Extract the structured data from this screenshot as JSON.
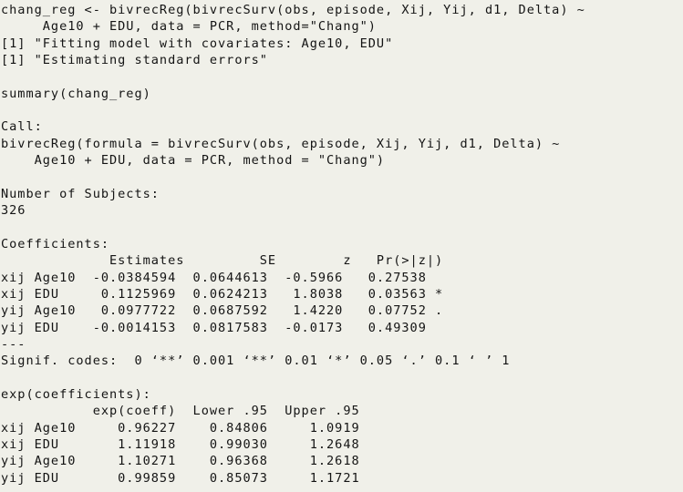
{
  "console": {
    "app": "R Console",
    "background_color": "#f0f0e9",
    "text_color": "#141414",
    "font_size_px": 13.6,
    "line_height_px": 18.35,
    "lines": [
      "chang_reg <- bivrecReg(bivrecSurv(obs, episode, Xij, Yij, d1, Delta) ~",
      "     Age10 + EDU, data = PCR, method=\"Chang\")",
      "[1] \"Fitting model with covariates: Age10, EDU\"",
      "[1] \"Estimating standard errors\"",
      "",
      "summary(chang_reg)",
      "",
      "Call:",
      "bivrecReg(formula = bivrecSurv(obs, episode, Xij, Yij, d1, Delta) ~",
      "    Age10 + EDU, data = PCR, method = \"Chang\")",
      "",
      "Number of Subjects:",
      "326",
      "",
      "Coefficients:",
      "             Estimates         SE        z   Pr(>|z|)",
      "xij Age10  -0.0384594  0.0644613  -0.5966   0.27538",
      "xij EDU     0.1125969  0.0624213   1.8038   0.03563 *",
      "yij Age10   0.0977722  0.0687592   1.4220   0.07752 .",
      "yij EDU    -0.0014153  0.0817583  -0.0173   0.49309",
      "---",
      "Signif. codes:  0 ‘**’ 0.001 ‘**’ 0.01 ‘*’ 0.05 ‘.’ 0.1 ‘ ’ 1",
      "",
      "exp(coefficients):",
      "           exp(coeff)  Lower .95  Upper .95",
      "xij Age10     0.96227    0.84806     1.0919",
      "xij EDU       1.11918    0.99030     1.2648",
      "yij Age10     1.10271    0.96368     1.2618",
      "yij EDU       0.99859    0.85073     1.1721"
    ]
  },
  "command": {
    "assignment_target": "chang_reg",
    "function": "bivrecReg",
    "formula": "bivrecSurv(obs, episode, Xij, Yij, d1, Delta) ~ Age10 + EDU",
    "data": "PCR",
    "method": "Chang",
    "summary_call": "summary(chang_reg)"
  },
  "messages": [
    "[1] \"Fitting model with covariates: Age10, EDU\"",
    "[1] \"Estimating standard errors\""
  ],
  "model": {
    "call_label": "Call:",
    "call_text": "bivrecReg(formula = bivrecSurv(obs, episode, Xij, Yij, d1, Delta) ~ Age10 + EDU, data = PCR, method = \"Chang\")",
    "subjects_label": "Number of Subjects:",
    "subjects_value": "326",
    "coefficients_label": "Coefficients:",
    "coefficients": {
      "headers": [
        "",
        "Estimates",
        "SE",
        "z",
        "Pr(>|z|)"
      ],
      "rows": [
        {
          "term": "xij Age10",
          "estimate": "-0.0384594",
          "se": "0.0644613",
          "z": "-0.5966",
          "p": "0.27538",
          "signif": ""
        },
        {
          "term": "xij EDU",
          "estimate": "0.1125969",
          "se": "0.0624213",
          "z": "1.8038",
          "p": "0.03563",
          "signif": "*"
        },
        {
          "term": "yij Age10",
          "estimate": "0.0977722",
          "se": "0.0687592",
          "z": "1.4220",
          "p": "0.07752",
          "signif": "."
        },
        {
          "term": "yij EDU",
          "estimate": "-0.0014153",
          "se": "0.0817583",
          "z": "-0.0173",
          "p": "0.49309",
          "signif": ""
        }
      ]
    },
    "separator": "---",
    "signif_codes": "Signif. codes:  0 ‘**’ 0.001 ‘**’ 0.01 ‘*’ 0.05 ‘.’ 0.1 ‘ ’ 1",
    "exp_coefficients_label": "exp(coefficients):",
    "exp_coefficients": {
      "headers": [
        "",
        "exp(coeff)",
        "Lower .95",
        "Upper .95"
      ],
      "rows": [
        {
          "term": "xij Age10",
          "exp_coeff": "0.96227",
          "lower95": "0.84806",
          "upper95": "1.0919"
        },
        {
          "term": "xij EDU",
          "exp_coeff": "1.11918",
          "lower95": "0.99030",
          "upper95": "1.2648"
        },
        {
          "term": "yij Age10",
          "exp_coeff": "1.10271",
          "lower95": "0.96368",
          "upper95": "1.2618"
        },
        {
          "term": "yij EDU",
          "exp_coeff": "0.99859",
          "lower95": "0.85073",
          "upper95": "1.1721"
        }
      ]
    }
  }
}
